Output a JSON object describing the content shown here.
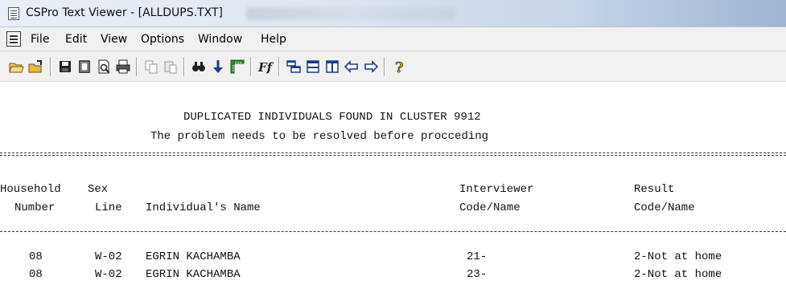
{
  "window": {
    "title": "CSPro Text Viewer - [ALLDUPS.TXT]"
  },
  "menu": {
    "items": [
      "File",
      "Edit",
      "View",
      "Options",
      "Window",
      "Help"
    ]
  },
  "toolbar": {
    "buttons": [
      "open-folder-icon",
      "open-file-icon",
      "save-icon",
      "blank-page-icon",
      "print-preview-icon",
      "print-icon",
      "copy-icon",
      "paste-icon",
      "find-icon",
      "down-arrow-icon",
      "ruler-icon",
      "font-icon",
      "tile-horizontal-icon",
      "tile-lines-icon",
      "tile-vertical-icon",
      "back-arrow-icon",
      "forward-arrow-icon",
      "help-icon"
    ]
  },
  "report": {
    "heading1": "DUPLICATED INDIVIDUALS FOUND IN CLUSTER 9912",
    "heading2": "The problem needs to be resolved before procceding",
    "columns": {
      "household_top": "Household",
      "household_bottom": "Number",
      "sex_top": "Sex",
      "line_bottom": "Line",
      "name": "Individual's Name",
      "interviewer_top": "Interviewer",
      "interviewer_bottom": "Code/Name",
      "result_top": "Result",
      "result_bottom": "Code/Name"
    },
    "rows": [
      {
        "household": "08",
        "line": "W-02",
        "name": "EGRIN KACHAMBA",
        "interviewer": "21-",
        "result": "2-Not at home"
      },
      {
        "household": "08",
        "line": "W-02",
        "name": "EGRIN KACHAMBA",
        "interviewer": "23-",
        "result": "2-Not at home"
      }
    ]
  }
}
